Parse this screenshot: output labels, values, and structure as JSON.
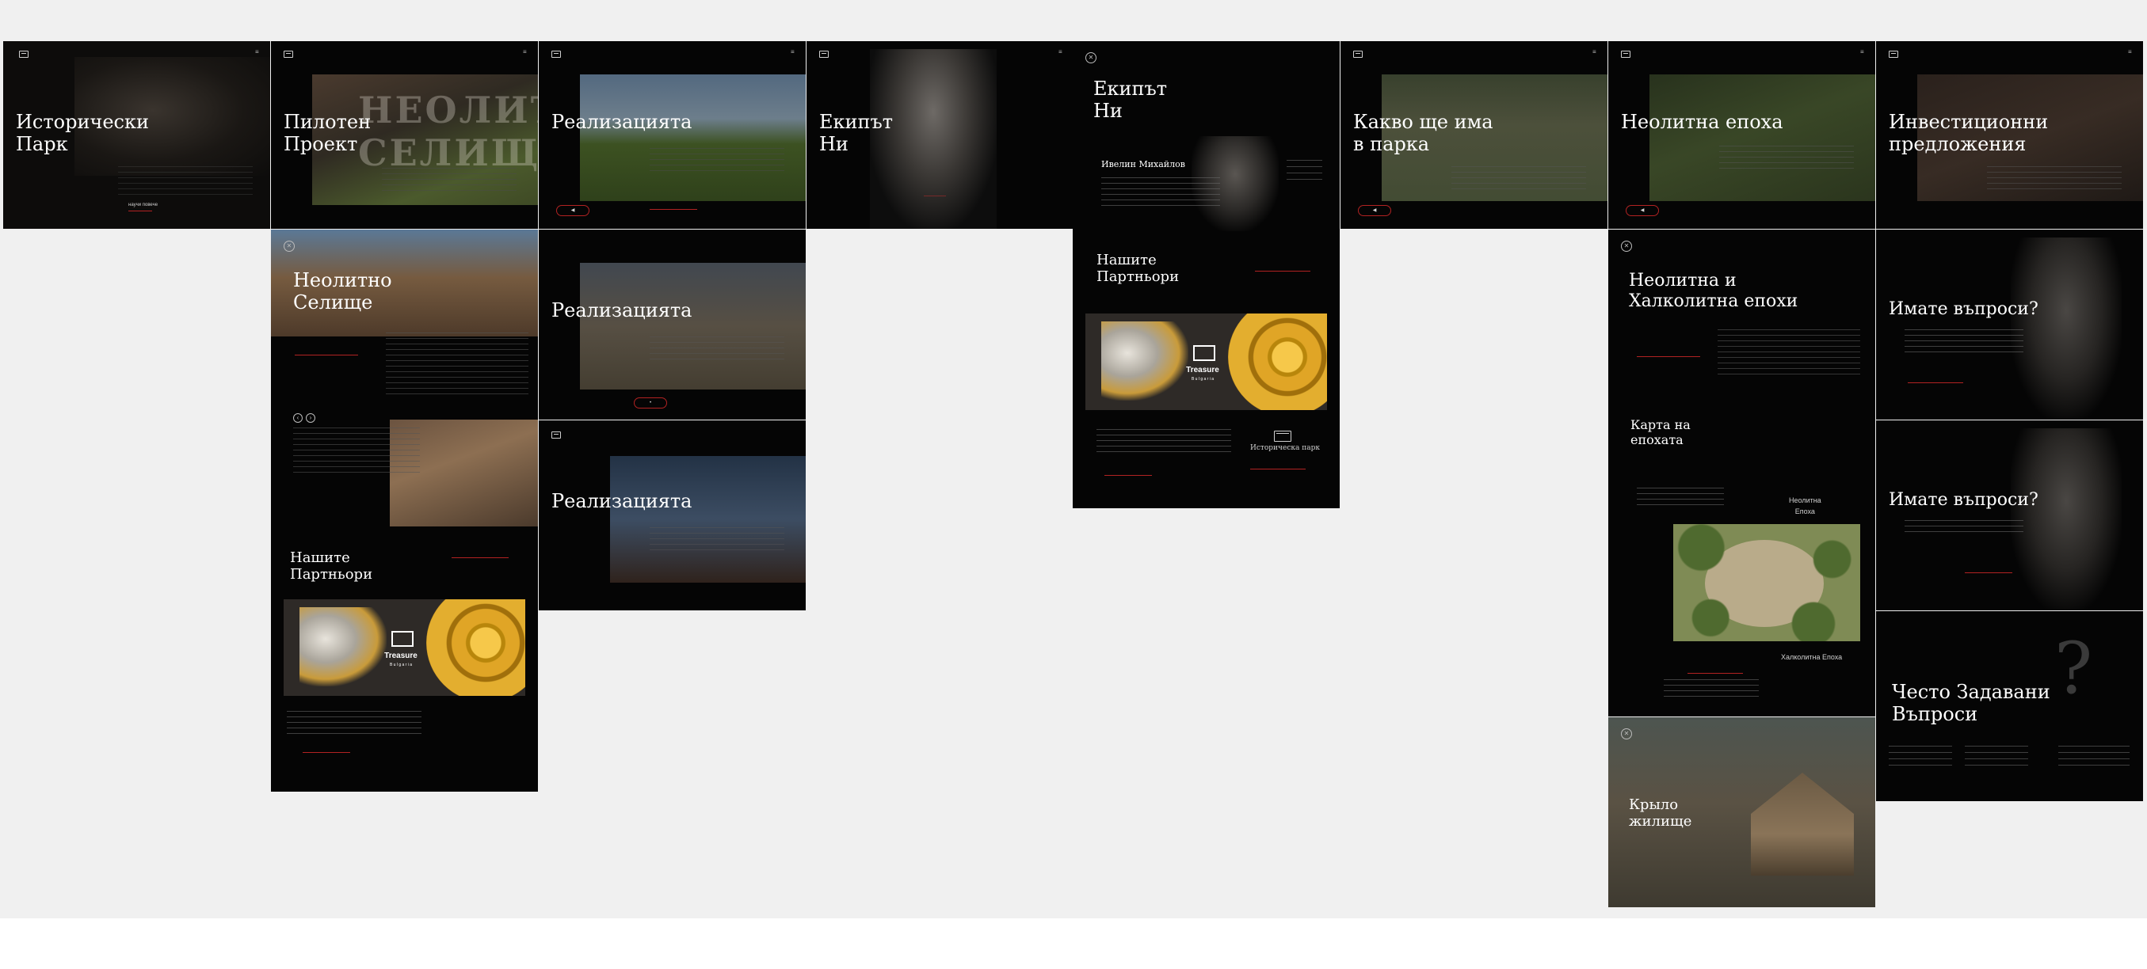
{
  "canvas": {
    "background": "#f0f0f0"
  },
  "frames": {
    "historical_park": {
      "title": "Исторически\n  Парк",
      "cta": "научи повече"
    },
    "pilot_project": {
      "title": "Пилотен\n  Проект",
      "photo_text": "НЕОЛИТНО\nСЕЛИЩЕ"
    },
    "realization_1": {
      "title": "Реализацията"
    },
    "team_1": {
      "title": "Екипът\n  Ни"
    },
    "team_2": {
      "title": "Екипът\n  Ни",
      "member_name": "Ивелин Михайлов",
      "partners_title": "Нашите\n  Партньори",
      "historical_park": "Историческа парк"
    },
    "what_in_park": {
      "title": "Какво ще има\n  в парка"
    },
    "neolithic_era": {
      "title": "Неолитна епоха"
    },
    "investment": {
      "title": "Инвестиционни\n  предложения"
    },
    "neolithic_settlement": {
      "title": "Неолитно\n  Селище",
      "partners_title": "Нашите\n  Партньори"
    },
    "realization_2": {
      "title": "Реализацията"
    },
    "realization_3": {
      "title": "Реализацията"
    },
    "neolithic_chalcolithic": {
      "title": "Неолитна и\n  Халколитна епохи",
      "map_title": "Карта на\n  епохата",
      "label_neolithic": "Неолитна\nЕпоха",
      "label_chalcolithic": "Халколитна Епоха"
    },
    "questions_1": {
      "title": "Имате въпроси?"
    },
    "questions_2": {
      "title": "Имате въпроси?"
    },
    "faq": {
      "title": "Често Задавани\n  Въпроси",
      "qmark": "?"
    },
    "dwelling": {
      "title": "Крыло\n  жилище"
    }
  },
  "partner_logo": {
    "brand": "Treasure",
    "sub": "B u l g a r i a"
  },
  "colors": {
    "accent": "#b22222",
    "frame": "#050505"
  }
}
